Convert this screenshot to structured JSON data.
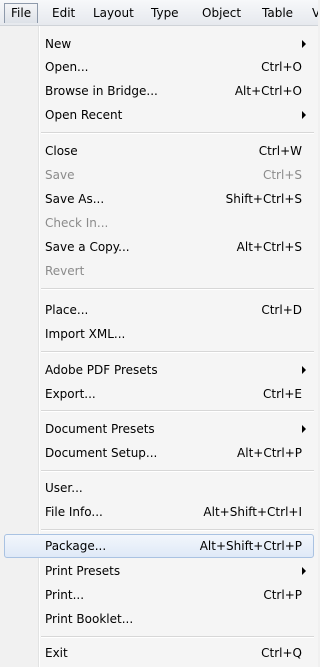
{
  "menubar": {
    "items": [
      "File",
      "Edit",
      "Layout",
      "Type",
      "Object",
      "Table",
      "V"
    ]
  },
  "file_menu": {
    "items": [
      {
        "label": "New",
        "submenu": true
      },
      {
        "label": "Open...",
        "shortcut": "Ctrl+O"
      },
      {
        "label": "Browse in Bridge...",
        "shortcut": "Alt+Ctrl+O"
      },
      {
        "label": "Open Recent",
        "submenu": true
      },
      {
        "label": "Close",
        "shortcut": "Ctrl+W"
      },
      {
        "label": "Save",
        "shortcut": "Ctrl+S",
        "disabled": true
      },
      {
        "label": "Save As...",
        "shortcut": "Shift+Ctrl+S"
      },
      {
        "label": "Check In...",
        "disabled": true
      },
      {
        "label": "Save a Copy...",
        "shortcut": "Alt+Ctrl+S"
      },
      {
        "label": "Revert",
        "disabled": true
      },
      {
        "label": "Place...",
        "shortcut": "Ctrl+D"
      },
      {
        "label": "Import XML..."
      },
      {
        "label": "Adobe PDF Presets",
        "submenu": true
      },
      {
        "label": "Export...",
        "shortcut": "Ctrl+E"
      },
      {
        "label": "Document Presets",
        "submenu": true
      },
      {
        "label": "Document Setup...",
        "shortcut": "Alt+Ctrl+P"
      },
      {
        "label": "User..."
      },
      {
        "label": "File Info...",
        "shortcut": "Alt+Shift+Ctrl+I"
      },
      {
        "label": "Package...",
        "shortcut": "Alt+Shift+Ctrl+P",
        "highlighted": true
      },
      {
        "label": "Print Presets",
        "submenu": true
      },
      {
        "label": "Print...",
        "shortcut": "Ctrl+P"
      },
      {
        "label": "Print Booklet..."
      },
      {
        "label": "Exit",
        "shortcut": "Ctrl+Q"
      }
    ]
  },
  "colors": {
    "highlight_border": "#a9c2e2",
    "disabled_text": "#8b8b8b"
  }
}
